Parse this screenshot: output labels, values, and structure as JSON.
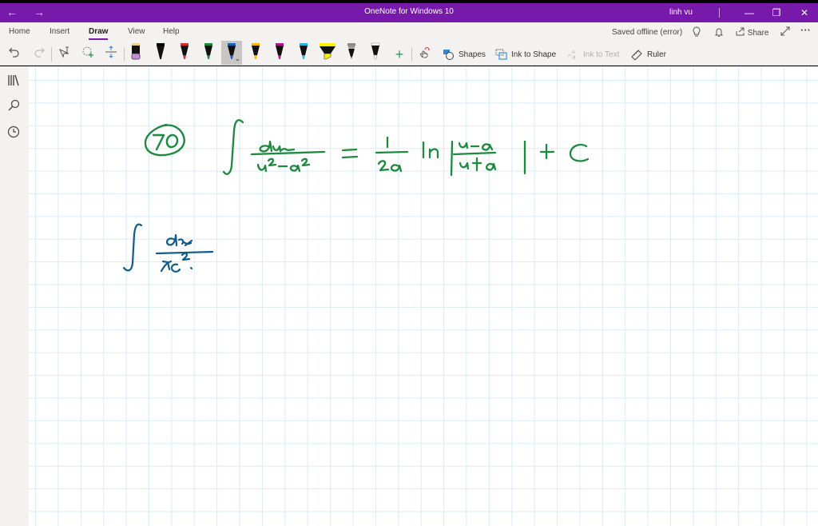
{
  "window": {
    "title": "OneNote for Windows 10",
    "user": "linh vu",
    "back_icon": "arrow-left-icon",
    "forward_icon": "arrow-right-icon",
    "controls": [
      "minimize",
      "restore",
      "close"
    ]
  },
  "ribbon": {
    "tabs": [
      {
        "label": "Home",
        "active": false
      },
      {
        "label": "Insert",
        "active": false
      },
      {
        "label": "Draw",
        "active": true
      },
      {
        "label": "View",
        "active": false
      },
      {
        "label": "Help",
        "active": false
      }
    ],
    "status": "Saved offline (error)",
    "share_label": "Share",
    "commands": {
      "shapes": "Shapes",
      "ink_to_shape": "Ink to Shape",
      "ink_to_text": "Ink to Text",
      "ruler": "Ruler"
    },
    "pens": [
      {
        "type": "eraser",
        "color": "#c78fd8"
      },
      {
        "type": "pen",
        "color": "#000000"
      },
      {
        "type": "pen",
        "color": "#d32f2f"
      },
      {
        "type": "pen",
        "color": "#1b8a3c"
      },
      {
        "type": "pen",
        "color": "#1565c0",
        "selected": true
      },
      {
        "type": "pen",
        "color": "#f5b700"
      },
      {
        "type": "pen",
        "color": "#b0168e"
      },
      {
        "type": "pen",
        "color": "#29b6e6"
      },
      {
        "type": "highlighter",
        "color": "#ffee00"
      },
      {
        "type": "pencil",
        "color": "#8a8a8a"
      },
      {
        "type": "pen",
        "color": "#ffffff"
      }
    ],
    "accent": "#7719aa"
  },
  "page": {
    "ink": [
      {
        "label": "problem-number",
        "text": "70",
        "color": "#1b8a3c"
      },
      {
        "label": "formula",
        "text": "∫ du/(u²−a²) = (1/2a) ln|(u−a)/(u+a)| + C",
        "color": "#1b8a3c"
      },
      {
        "label": "work",
        "text": "∫ dx/x²",
        "color": "#0d5c8c"
      }
    ]
  }
}
